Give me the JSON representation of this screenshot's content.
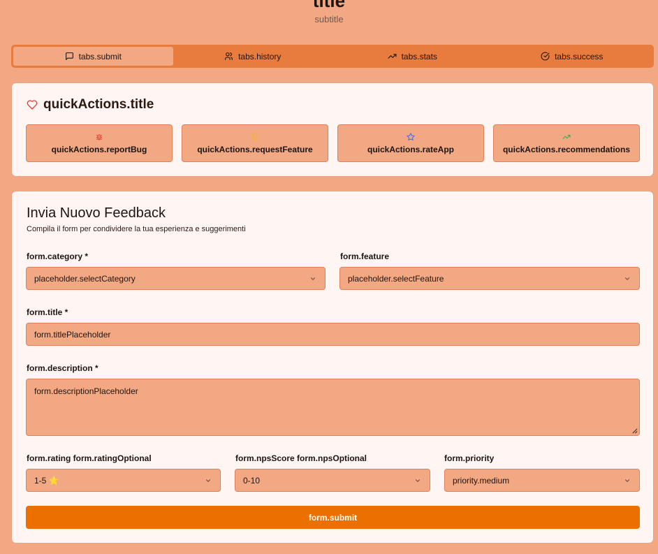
{
  "header": {
    "title": "title",
    "subtitle": "subtitle"
  },
  "tabs": [
    {
      "label": "tabs.submit",
      "icon": "message-square-icon",
      "active": true
    },
    {
      "label": "tabs.history",
      "icon": "users-icon",
      "active": false
    },
    {
      "label": "tabs.stats",
      "icon": "trending-up-icon",
      "active": false
    },
    {
      "label": "tabs.success",
      "icon": "check-circle-icon",
      "active": false
    }
  ],
  "quickActions": {
    "title": "quickActions.title",
    "icon": "heart-icon",
    "items": [
      {
        "label": "quickActions.reportBug",
        "icon": "bug-icon",
        "color": "#e53935"
      },
      {
        "label": "quickActions.requestFeature",
        "icon": "lightbulb-icon",
        "color": "#f5b800"
      },
      {
        "label": "quickActions.rateApp",
        "icon": "star-icon",
        "color": "#3b6ee8"
      },
      {
        "label": "quickActions.recommendations",
        "icon": "trending-up-icon",
        "color": "#2fae4e"
      }
    ]
  },
  "form": {
    "title": "Invia Nuovo Feedback",
    "description": "Compila il form per condividere la tua esperienza e suggerimenti",
    "category_label": "form.category *",
    "category_value": "placeholder.selectCategory",
    "feature_label": "form.feature",
    "feature_value": "placeholder.selectFeature",
    "title_label": "form.title *",
    "title_placeholder": "form.titlePlaceholder",
    "description_label": "form.description *",
    "description_placeholder": "form.descriptionPlaceholder",
    "rating_label": "form.rating form.ratingOptional",
    "rating_value": "1-5 ⭐",
    "nps_label": "form.npsScore form.npsOptional",
    "nps_value": "0-10",
    "priority_label": "form.priority",
    "priority_value": "priority.medium",
    "submit_label": "form.submit"
  },
  "colors": {
    "accent": "#ec7000",
    "tabbar": "#e87c3e",
    "background": "#f2a882",
    "card": "#fff5f2"
  }
}
